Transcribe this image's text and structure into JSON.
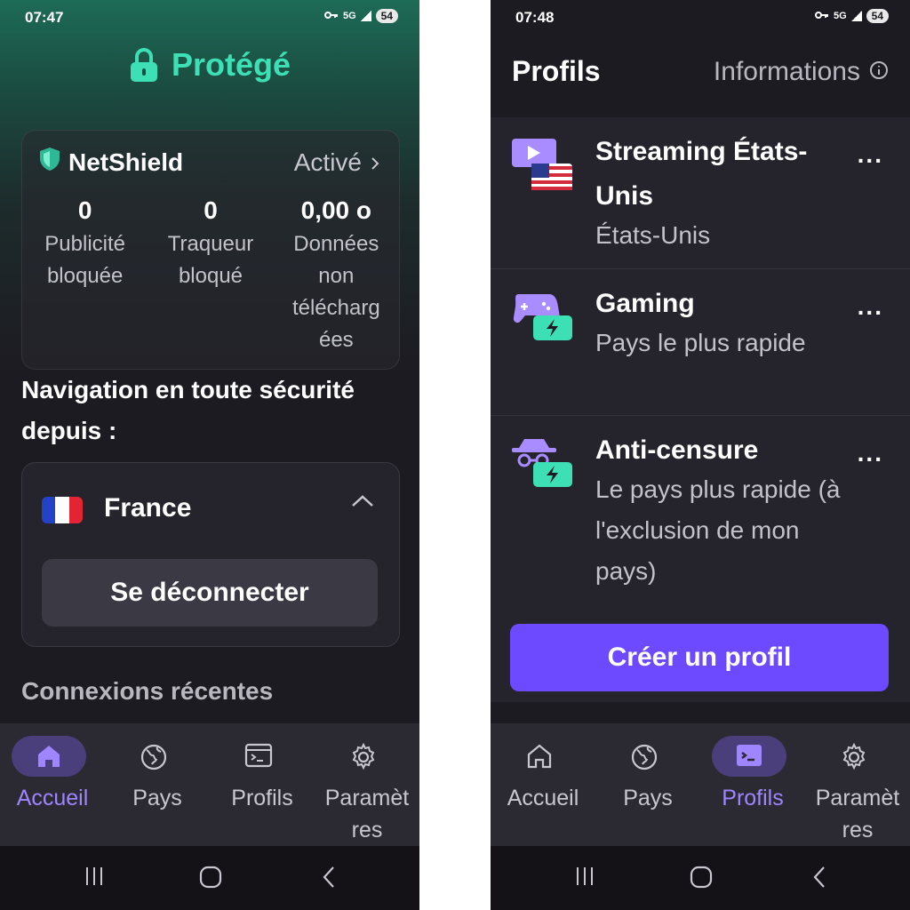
{
  "left": {
    "status": {
      "time": "07:47",
      "network": "5G",
      "battery": "54"
    },
    "header": {
      "title": "Protégé",
      "accent": "#3de0b4"
    },
    "netshield": {
      "name": "NetShield",
      "status": "Activé",
      "stats": [
        {
          "value": "0",
          "label": "Publicité bloquée"
        },
        {
          "value": "0",
          "label": "Traqueur bloqué"
        },
        {
          "value": "0,00 o",
          "label": "Données non téléchargées"
        }
      ]
    },
    "nav_since": "Navigation en toute sécurité depuis :",
    "country": {
      "name": "France",
      "disconnect_label": "Se déconnecter"
    },
    "recent_label": "Connexions récentes",
    "bottom_nav": [
      {
        "label": "Accueil",
        "icon": "home-icon",
        "active": true
      },
      {
        "label": "Pays",
        "icon": "globe-icon",
        "active": false
      },
      {
        "label": "Profils",
        "icon": "terminal-icon",
        "active": false
      },
      {
        "label": "Paramèt\nres",
        "icon": "gear-icon",
        "active": false
      }
    ]
  },
  "right": {
    "status": {
      "time": "07:48",
      "network": "5G",
      "battery": "54"
    },
    "header": {
      "title": "Profils",
      "info_label": "Informations"
    },
    "profiles": [
      {
        "name": "Streaming États-Unis",
        "subtitle": "États-Unis",
        "icon": "streaming-icon"
      },
      {
        "name": "Gaming",
        "subtitle": "Pays le plus rapide",
        "icon": "gaming-icon"
      },
      {
        "name": "Anti-censure",
        "subtitle": "Le pays plus rapide (à l'exclusion de mon pays)",
        "icon": "anti-censorship-icon"
      }
    ],
    "more_label": "...",
    "create_label": "Créer un profil",
    "bottom_nav": [
      {
        "label": "Accueil",
        "icon": "home-icon",
        "active": false
      },
      {
        "label": "Pays",
        "icon": "globe-icon",
        "active": false
      },
      {
        "label": "Profils",
        "icon": "terminal-icon",
        "active": true
      },
      {
        "label": "Paramèt\nres",
        "icon": "gear-icon",
        "active": false
      }
    ],
    "primary_color": "#6d4aff"
  }
}
